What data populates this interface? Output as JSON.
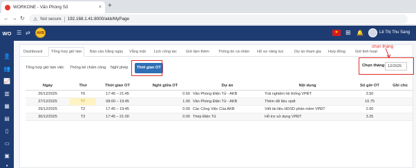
{
  "browser": {
    "tab_title": "WORKONE - Văn Phòng Số",
    "tab_close": "×",
    "new_tab": "+",
    "back": "←",
    "forward": "→",
    "reload": "↻",
    "security_label": "Not secure",
    "url": "192.168.1.41:8000/akb/MyPage"
  },
  "app": {
    "brand": "WO",
    "logo_text": "AKB",
    "flag_glyph": "★",
    "user_name": "Lê Thị Thu Sang"
  },
  "main_tabs": [
    {
      "label": "Dashboard"
    },
    {
      "label": "Tổng hợp giờ làm"
    },
    {
      "label": "Báo cáo hằng ngày"
    },
    {
      "label": "Vắng mặt"
    },
    {
      "label": "Lịch công tác"
    },
    {
      "label": "Giờ làm thêm"
    },
    {
      "label": "Thông tin cá nhân"
    },
    {
      "label": "Hồ sơ năng lực"
    },
    {
      "label": "Dự án tham gia"
    },
    {
      "label": "Hợp đồng"
    },
    {
      "label": "Giờ linh hoạt"
    }
  ],
  "sub_tabs": [
    {
      "label": "Tổng hợp giờ làm việc"
    },
    {
      "label": "Thống kê chấm công"
    },
    {
      "label": "Nghỉ phép"
    },
    {
      "label": "Thời gian OT"
    }
  ],
  "filter": {
    "label": "Chọn tháng:",
    "value": "12/2025",
    "annotation": "chọn tháng"
  },
  "table": {
    "headers": [
      "Ngày",
      "Thứ",
      "Thời gian OT",
      "Nghỉ giữa OT",
      "Dự án",
      "Nội dung",
      "Số giờ OT",
      "Ghi chú"
    ],
    "rows": [
      {
        "date": "26/12/2025",
        "weekday": "T6",
        "ot_time": "17:45 – 21:45",
        "break": "0.50",
        "project": "Văn Phòng Điện Tử - AKB",
        "content": "Trải nghiệm hệ thống VPĐT",
        "hours": "3.50",
        "note": ""
      },
      {
        "date": "27/12/2025",
        "weekday": "T7",
        "ot_time": "08:00 – 19:45",
        "break": "1.00",
        "project": "Văn Phòng Điện Tử - AKB",
        "content": "Thêm dữ liệu vpdt",
        "hours": "10.75",
        "note": ""
      },
      {
        "date": "29/12/2025",
        "weekday": "T2",
        "ot_time": "17:45 – 19:45",
        "break": "0.00",
        "project": "Các Công Việc Của AKB",
        "content": "Viết tài liệu HDSD phần mềm VPĐT",
        "hours": "2.00",
        "note": ""
      },
      {
        "date": "30/12/2025",
        "weekday": "T3",
        "ot_time": "17:45 – 21:00",
        "break": "0.00",
        "project": "Thép Điện Tử",
        "content": "Hỗ trợ sử dụng VPĐT",
        "hours": "3.25",
        "note": ""
      }
    ]
  },
  "colors": {
    "header_bg": "#1e3c72",
    "active_subtab": "#2f6fb5",
    "annotation": "#e02b2b",
    "weekend_highlight": "#fff3c4"
  },
  "icons": {
    "sidebar": [
      "user-icon",
      "users-icon",
      "chart-icon",
      "stats-icon",
      "calendar-icon",
      "inbox-icon",
      "document-icon",
      "clipboard-icon",
      "building-icon",
      "archive-icon"
    ]
  }
}
